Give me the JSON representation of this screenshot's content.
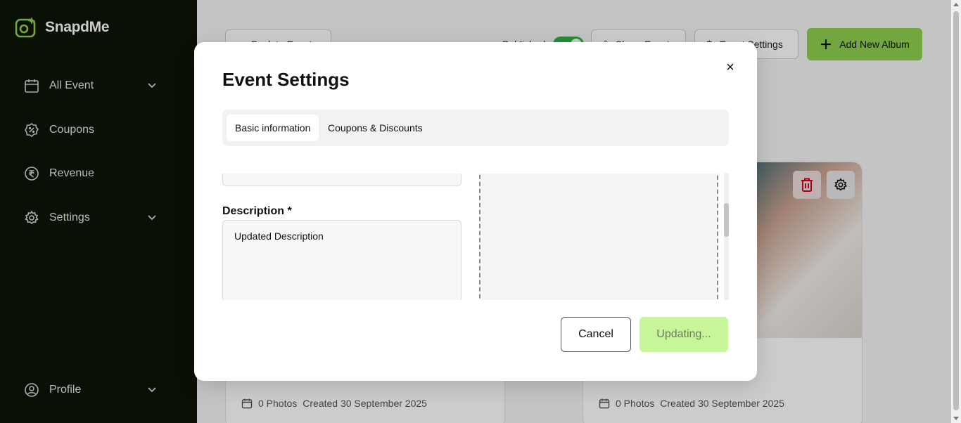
{
  "app": {
    "name": "SnapdMe"
  },
  "sidebar": {
    "items": [
      {
        "label": "All Event",
        "icon": "calendar-icon",
        "has_chevron": true
      },
      {
        "label": "Coupons",
        "icon": "coupon-icon",
        "has_chevron": false
      },
      {
        "label": "Revenue",
        "icon": "rupee-icon",
        "has_chevron": false
      },
      {
        "label": "Settings",
        "icon": "gear-icon",
        "has_chevron": true
      }
    ],
    "profile": {
      "label": "Profile",
      "icon": "user-icon"
    }
  },
  "toolbar": {
    "back_label": "Back to Event",
    "published_label": "Published",
    "published_on": true,
    "share_label": "Share Event",
    "event_settings_label": "Event Settings",
    "add_album_label": "Add New Album"
  },
  "albums": [
    {
      "photos": "0 Photos",
      "created": "Created 30 September 2025"
    },
    {
      "photos": "0 Photos",
      "created": "Created 30 September 2025"
    }
  ],
  "modal": {
    "title": "Event Settings",
    "close_label": "×",
    "tabs": [
      {
        "label": "Basic information",
        "active": true
      },
      {
        "label": "Coupons & Discounts",
        "active": false
      }
    ],
    "description_label": "Description *",
    "description_value": "Updated Description",
    "cancel_label": "Cancel",
    "submit_label": "Updating..."
  },
  "colors": {
    "sidebar_bg": "#0d1508",
    "accent": "#8fd14f",
    "accent_disabled": "#c8f59a",
    "toggle_on": "#2fb344",
    "delete_icon": "#d0021b"
  }
}
